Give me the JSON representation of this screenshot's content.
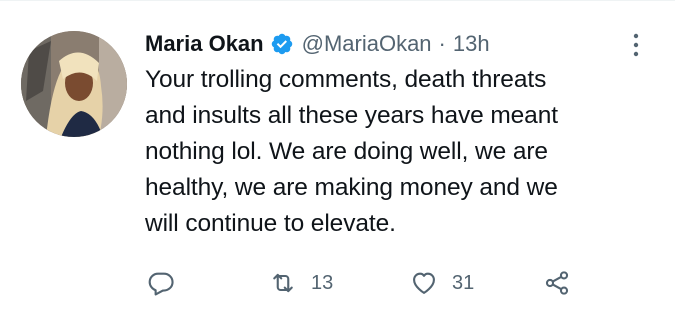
{
  "tweet": {
    "author_name": "Maria Okan",
    "handle": "@MariaOkan",
    "separator": "·",
    "time": "13h",
    "text_lines": [
      "Your trolling comments, death threats",
      "and insults all these years have meant",
      "nothing lol. We are doing well, we are",
      "healthy, we are making money and we",
      "will continue to elevate."
    ]
  },
  "actions": {
    "reply_count": "",
    "retweet_count": "13",
    "like_count": "31"
  },
  "colors": {
    "verified": "#1d9bf0",
    "muted": "#536471",
    "text": "#0f1419"
  },
  "icons": [
    "verified-badge-icon",
    "more-icon",
    "reply-icon",
    "retweet-icon",
    "like-icon",
    "share-icon"
  ]
}
